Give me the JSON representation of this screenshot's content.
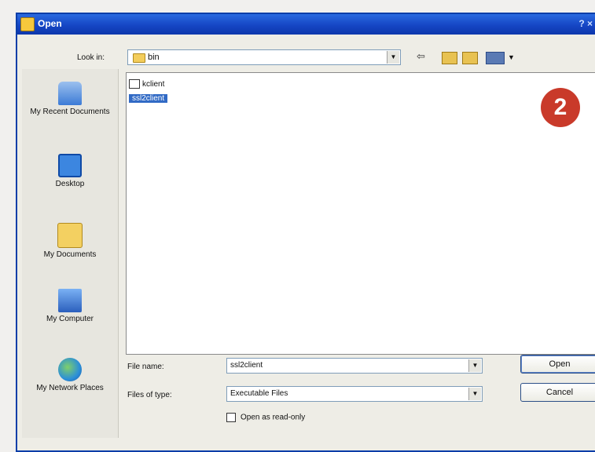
{
  "window": {
    "title": "Open",
    "help": "? ×"
  },
  "look_in": {
    "label": "Look in:",
    "value": "bin"
  },
  "toolbar": {
    "back": "⇦"
  },
  "places": [
    {
      "label": "My Recent Documents",
      "icon": "recent-docs-icon"
    },
    {
      "label": "Desktop",
      "icon": "desktop-icon"
    },
    {
      "label": "My Documents",
      "icon": "my-documents-icon"
    },
    {
      "label": "My Computer",
      "icon": "my-computer-icon"
    },
    {
      "label": "My Network Places",
      "icon": "network-places-icon"
    }
  ],
  "files": [
    {
      "name": "kclient",
      "selected": false
    },
    {
      "name": "ssl2client",
      "selected": true
    }
  ],
  "badge": "2",
  "file_name": {
    "label": "File name:",
    "value": "ssl2client"
  },
  "file_type": {
    "label": "Files of type:",
    "value": "Executable Files"
  },
  "read_only_label": "Open as read-only",
  "buttons": {
    "open": "Open",
    "cancel": "Cancel"
  },
  "colors": {
    "title_bar": "#1546c4",
    "selection": "#316ac5",
    "badge": "#c93a2a"
  }
}
